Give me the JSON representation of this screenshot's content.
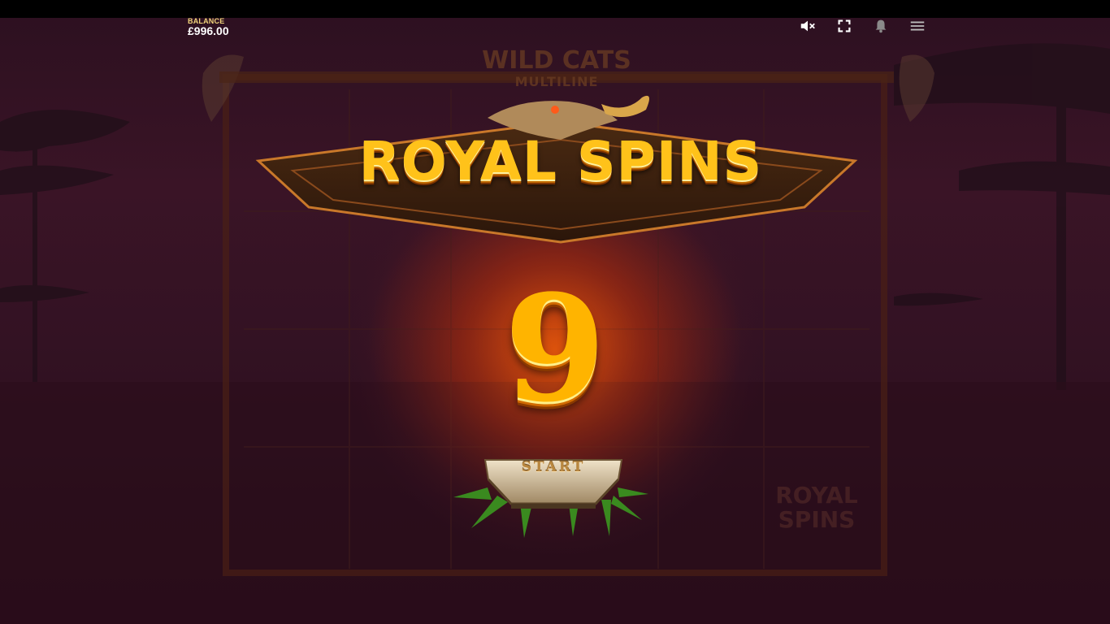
{
  "hud": {
    "balance_label": "BALANCE",
    "balance_value": "£996.00",
    "icons": [
      "sound-muted-icon",
      "fullscreen-icon",
      "notification-bell-icon",
      "menu-icon"
    ]
  },
  "game": {
    "logo_line1": "WILD CATS",
    "logo_line2": "MULTILINE",
    "banner_title": "ROYAL SPINS",
    "spins_count": "9",
    "start_label": "START",
    "background_symbol_line1": "ROYAL",
    "background_symbol_line2": "SPINS"
  },
  "colors": {
    "gold": "#ffc21a",
    "glow": "#d2460a",
    "background": "#2a0f1c"
  }
}
